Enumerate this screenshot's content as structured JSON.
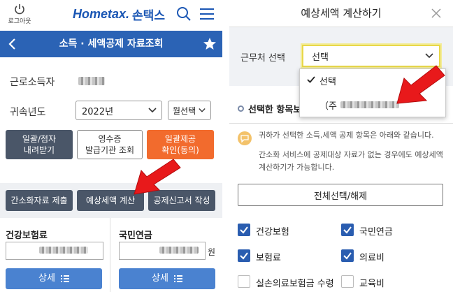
{
  "left": {
    "header": {
      "logout_label": "로그아웃",
      "logo_home": "Home",
      "logo_tax": "tax.",
      "logo_korean": "손택스",
      "search_icon": "search-icon",
      "menu_icon": "hamburger-menu-icon"
    },
    "titlebar": {
      "title": "소득 · 세액공제 자료조회"
    },
    "form": {
      "earner_label": "근로소득자",
      "year_label": "귀속년도",
      "year_value": "2022년",
      "month_value": "월선택"
    },
    "buttons": {
      "bulk_download": "일괄/점자\n내려받기",
      "receipt_lookup": "영수증\n발급기관 조회",
      "bulk_provide": "일괄제공\n확인(동의)",
      "simplified_submit": "간소화자료 제출",
      "estimate_tax": "예상세액 계산",
      "deduction_report": "공제신고서 작성"
    },
    "cards": {
      "health_label": "건강보험료",
      "pension_label": "국민연금",
      "won_unit": "원",
      "detail_label": "상세"
    }
  },
  "right": {
    "modal_title": "예상세액 계산하기",
    "workplace_label": "근무처 선택",
    "select_value": "선택",
    "dropdown": {
      "options": [
        "선택",
        "（주"
      ]
    },
    "section_title": "선택한 항목보기",
    "info_line1": "귀하가 선택한 소득,세액 공제 항목은 아래와 같습니다.",
    "info_line2": "간소화 서비스에 공제대상 자료가 없는 경우에도 예상세액",
    "info_line3": "계산하기가 가능합니다.",
    "select_all_label": "전체선택/해제",
    "checkboxes": [
      {
        "label": "건강보험",
        "checked": true
      },
      {
        "label": "국민연금",
        "checked": true
      },
      {
        "label": "보험료",
        "checked": true
      },
      {
        "label": "의료비",
        "checked": true
      },
      {
        "label": "실손의료보험금 수령",
        "checked": false
      },
      {
        "label": "교육비",
        "checked": false
      }
    ]
  },
  "colors": {
    "brand_blue": "#2b63b5",
    "orange": "#f26b2d",
    "arrow_red": "#e8191b",
    "highlight_yellow": "#e8d84a"
  }
}
